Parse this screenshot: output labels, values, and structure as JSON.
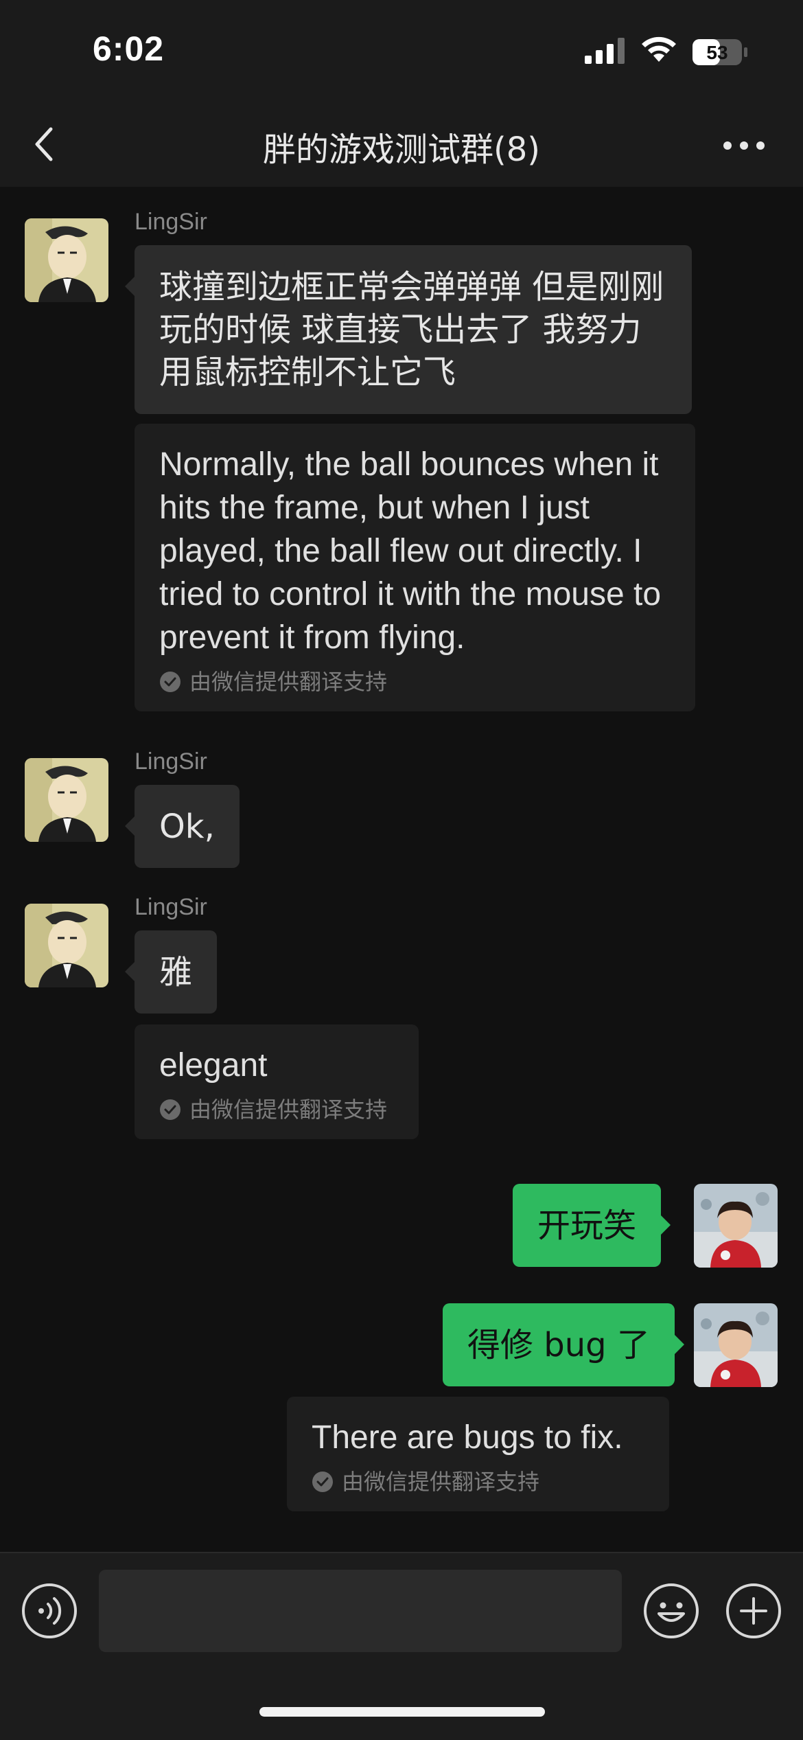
{
  "status_bar": {
    "time": "6:02",
    "battery": "53"
  },
  "header": {
    "title": "胖的游戏测试群(8)"
  },
  "messages": [
    {
      "sender": "LingSir",
      "text": "球撞到边框正常会弹弹弹 但是刚刚玩的时候 球直接飞出去了 我努力用鼠标控制不让它飞",
      "translation": "Normally, the ball bounces when it hits the frame, but when I just played, the ball flew out directly. I tried to control it with the mouse to prevent it from flying.",
      "translation_note": "由微信提供翻译支持"
    },
    {
      "sender": "LingSir",
      "text": "Ok,"
    },
    {
      "sender": "LingSir",
      "text": "雅",
      "translation": "elegant",
      "translation_note": "由微信提供翻译支持"
    },
    {
      "text": "开玩笑"
    },
    {
      "text": "得修 bug 了",
      "translation": "There are bugs to fix.",
      "translation_note": "由微信提供翻译支持"
    }
  ],
  "colors": {
    "background": "#111111",
    "bubble_incoming": "#2c2c2c",
    "bubble_outgoing": "#2eba5f",
    "translation_bg": "#1e1e1e"
  },
  "icons": {
    "back": "chevron-left-icon",
    "more": "more-dots-icon",
    "voice": "voice-icon",
    "emoji": "emoji-icon",
    "plus": "plus-icon"
  }
}
